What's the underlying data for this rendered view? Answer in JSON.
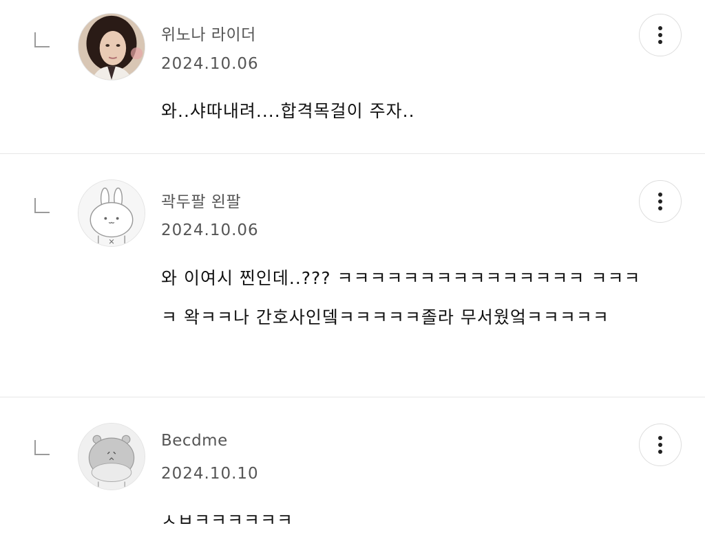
{
  "comments": [
    {
      "nickname": "위노나 라이더",
      "date": "2024.10.06",
      "text": "와..샤따내려....합격목걸이 주자..",
      "avatar": "photo-avatar-icon"
    },
    {
      "nickname": "곽두팔 왼팔",
      "date": "2024.10.06",
      "text": "와 이여시 찐인데..??? ㅋㅋㅋㅋㅋㅋㅋㅋㅋㅋㅋㅋㅋㅋㅋ ㅋㅋㅋㅋ 왁ㅋㅋ나 간호사인뎈ㅋㅋㅋㅋㅋ졸라 무서웠엌ㅋㅋㅋㅋㅋ",
      "avatar": "bunny-avatar-icon"
    },
    {
      "nickname": "Becdme",
      "date": "2024.10.10",
      "text": "ㅅㅂㅋㅋㅋㅋㅋㅋ",
      "avatar": "hamster-avatar-icon"
    }
  ],
  "icons": {
    "reply": "reply-corner-icon",
    "more": "more-vertical-icon"
  },
  "colors": {
    "divider": "#e6e6e6",
    "meta_text": "#555555",
    "body_text": "#111111"
  }
}
